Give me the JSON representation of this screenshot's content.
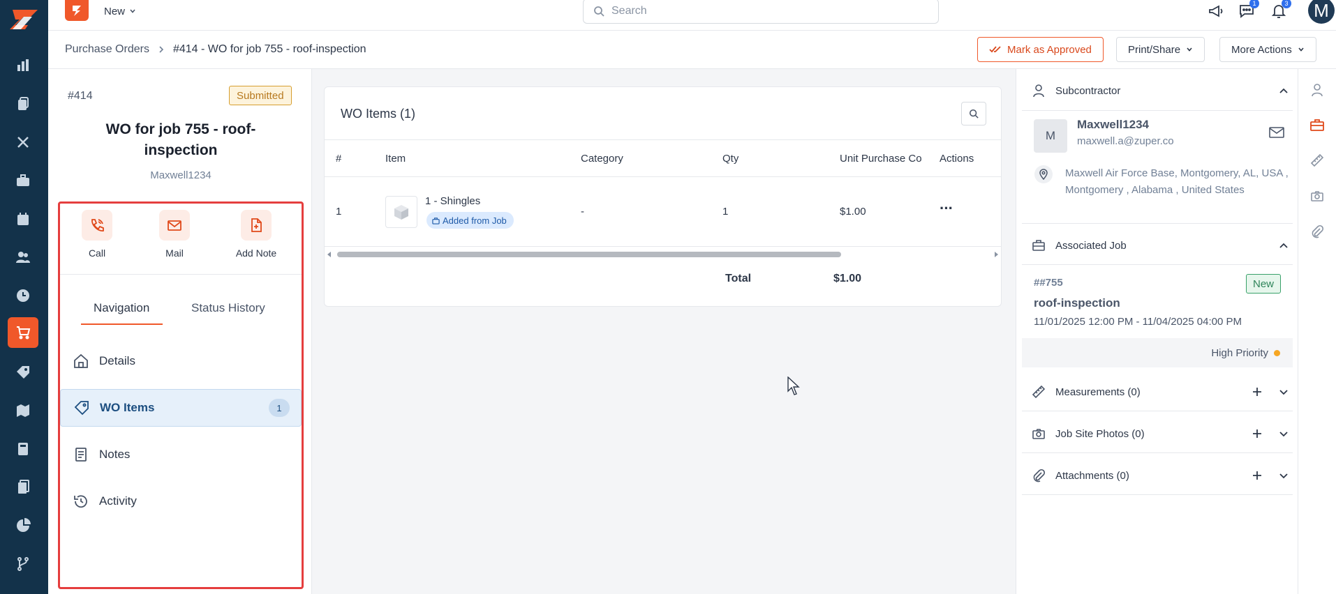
{
  "topbar": {
    "new_label": "New",
    "search_placeholder": "Search",
    "chat_badge": "1",
    "notif_badge": "3",
    "avatar_initial": "M"
  },
  "breadcrumb": {
    "root": "Purchase Orders",
    "current": "#414 - WO for job 755 - roof-inspection"
  },
  "header_actions": {
    "approve": "Mark as Approved",
    "print_share": "Print/Share",
    "more_actions": "More Actions"
  },
  "po": {
    "number": "#414",
    "status": "Submitted",
    "title": "WO for job 755 - roof-inspection",
    "subcontractor": "Maxwell1234"
  },
  "quick_actions": {
    "call": "Call",
    "mail": "Mail",
    "add_note": "Add Note"
  },
  "tabs": {
    "navigation": "Navigation",
    "status_history": "Status History"
  },
  "nav": {
    "details": "Details",
    "wo_items": "WO Items",
    "wo_items_count": "1",
    "notes": "Notes",
    "activity": "Activity"
  },
  "wo_items": {
    "title": "WO Items (1)",
    "columns": [
      "#",
      "Item",
      "Category",
      "Qty",
      "Unit Purchase Co",
      "Actions"
    ],
    "rows": [
      {
        "num": "1",
        "item": "1 - Shingles",
        "tag": "Added from Job",
        "category": "-",
        "qty": "1",
        "unit_cost": "$1.00",
        "actions": "···"
      }
    ],
    "total_label": "Total",
    "total_value": "$1.00"
  },
  "subcontractor_section": {
    "title": "Subcontractor",
    "avatar_initial": "M",
    "name": "Maxwell1234",
    "email": "maxwell.a@zuper.co",
    "address": "Maxwell Air Force Base, Montgomery, AL, USA , Montgomery , Alabama , United States"
  },
  "associated_job": {
    "title": "Associated Job",
    "number": "##755",
    "status": "New",
    "name": "roof-inspection",
    "dates": "11/01/2025 12:00 PM - 11/04/2025 04:00 PM",
    "priority": "High Priority"
  },
  "collapsibles": {
    "measurements": "Measurements (0)",
    "photos": "Job Site Photos (0)",
    "attachments": "Attachments (0)"
  },
  "colors": {
    "rail": "#13324a",
    "accent": "#f0582a",
    "highlight_border": "#e53e3e"
  }
}
